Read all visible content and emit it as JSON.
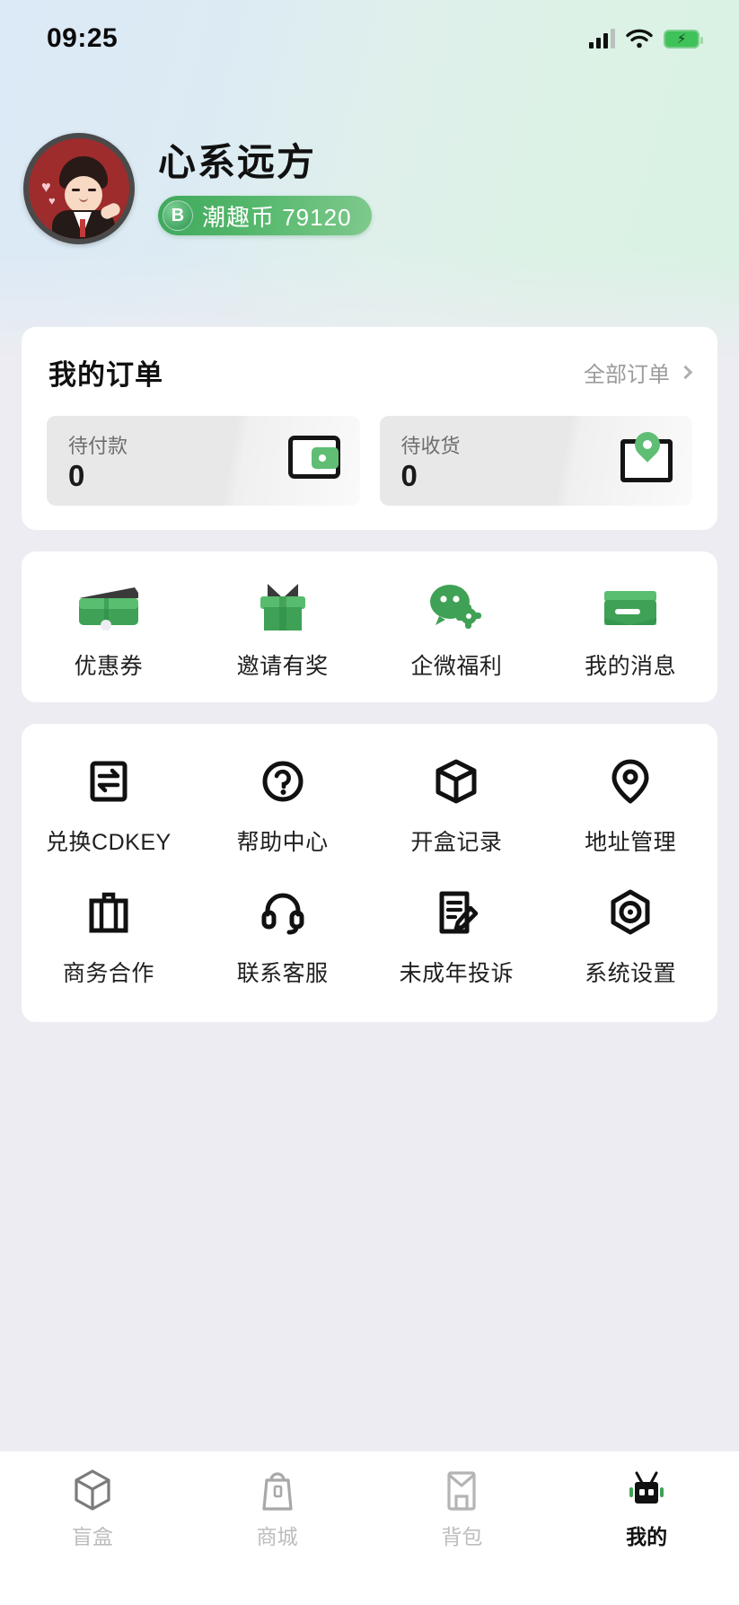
{
  "status_bar": {
    "time": "09:25",
    "signal_icon": "cellular-signal-icon",
    "wifi_icon": "wifi-icon",
    "battery_icon": "battery-charging-icon"
  },
  "profile": {
    "avatar_name": "user-avatar",
    "nickname": "心系远方",
    "coin": {
      "badge_letter": "B",
      "label": "潮趣币",
      "amount": "79120",
      "text": "潮趣币 79120",
      "pill_color": "#4FB268"
    }
  },
  "orders": {
    "title": "我的订单",
    "all_orders_label": "全部订单",
    "tiles": [
      {
        "label": "待付款",
        "count": "0",
        "icon": "wallet-icon"
      },
      {
        "label": "待收货",
        "count": "0",
        "icon": "parcel-location-icon"
      }
    ]
  },
  "promo_grid": {
    "items": [
      {
        "label": "优惠券",
        "icon": "coupon-ticket-icon"
      },
      {
        "label": "邀请有奖",
        "icon": "gift-box-icon"
      },
      {
        "label": "企微福利",
        "icon": "wechat-work-benefit-icon"
      },
      {
        "label": "我的消息",
        "icon": "message-envelope-icon"
      }
    ]
  },
  "tools_grid": {
    "items": [
      {
        "label": "兑换CDKEY",
        "icon": "exchange-cdkey-icon"
      },
      {
        "label": "帮助中心",
        "icon": "question-help-icon"
      },
      {
        "label": "开盒记录",
        "icon": "open-box-record-icon"
      },
      {
        "label": "地址管理",
        "icon": "location-pin-icon"
      },
      {
        "label": "商务合作",
        "icon": "briefcase-icon"
      },
      {
        "label": "联系客服",
        "icon": "headset-support-icon"
      },
      {
        "label": "未成年投诉",
        "icon": "document-pen-complaint-icon"
      },
      {
        "label": "系统设置",
        "icon": "hexagon-settings-icon"
      }
    ]
  },
  "tabbar": {
    "tabs": [
      {
        "label": "盲盒",
        "icon": "blind-box-cube-icon",
        "active": false
      },
      {
        "label": "商城",
        "icon": "shopping-bag-icon",
        "active": false
      },
      {
        "label": "背包",
        "icon": "backpack-envelope-icon",
        "active": false
      },
      {
        "label": "我的",
        "icon": "robot-profile-icon",
        "active": true
      }
    ],
    "active_color": "#121212",
    "inactive_color": "#BDBDBD"
  },
  "colors": {
    "brand_green": "#4FB268",
    "page_background": "#ECECF2",
    "card_background": "#FFFFFF"
  }
}
